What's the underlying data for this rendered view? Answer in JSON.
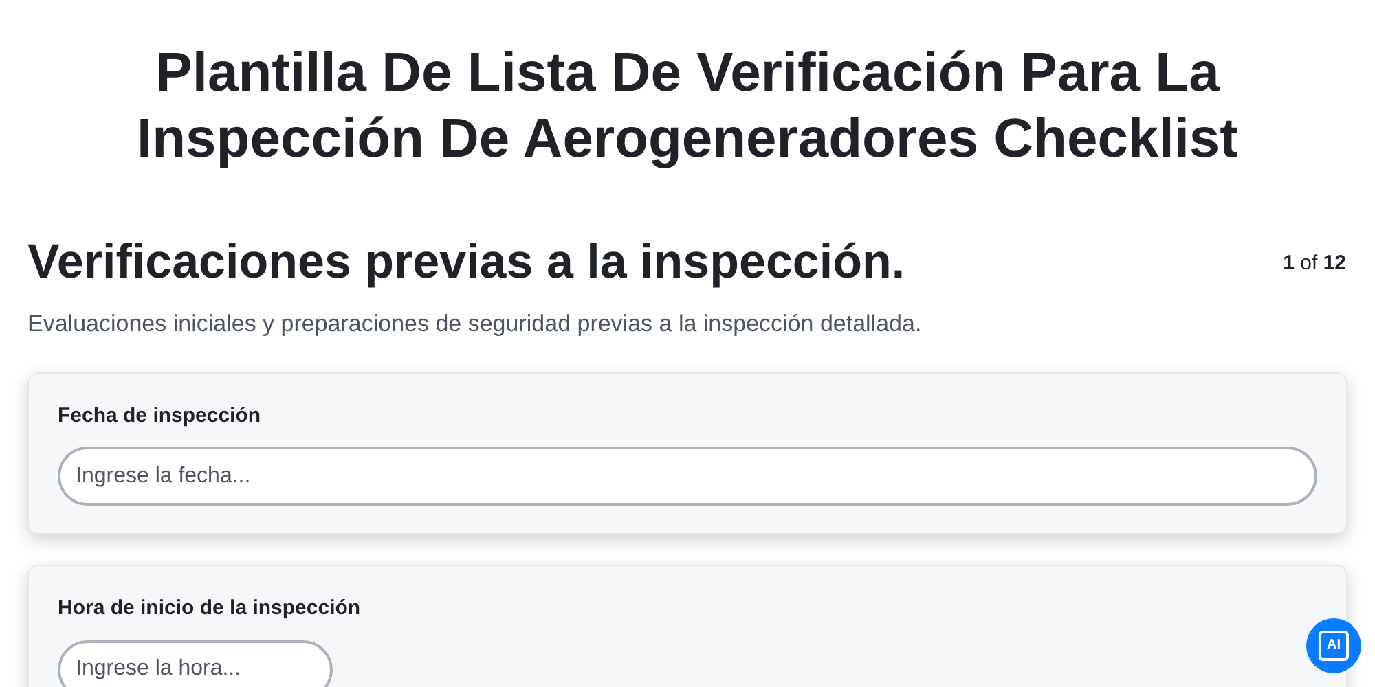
{
  "title": "Plantilla De Lista De Verificación Para La Inspección De Aerogeneradores Checklist",
  "section": {
    "heading": "Verificaciones previas a la inspección.",
    "page_counter": "**1** of **12**",
    "description": "Evaluaciones iniciales y preparaciones de seguridad previas a la inspección detallada."
  },
  "fields": [
    {
      "kind": "date",
      "label": "Fecha de inspección",
      "placeholder": "Ingrese la fecha..."
    },
    {
      "kind": "time",
      "label": "Hora de inicio de la inspección",
      "placeholder": "Ingrese la hora..."
    }
  ],
  "ai_button": {
    "label": "AI"
  }
}
